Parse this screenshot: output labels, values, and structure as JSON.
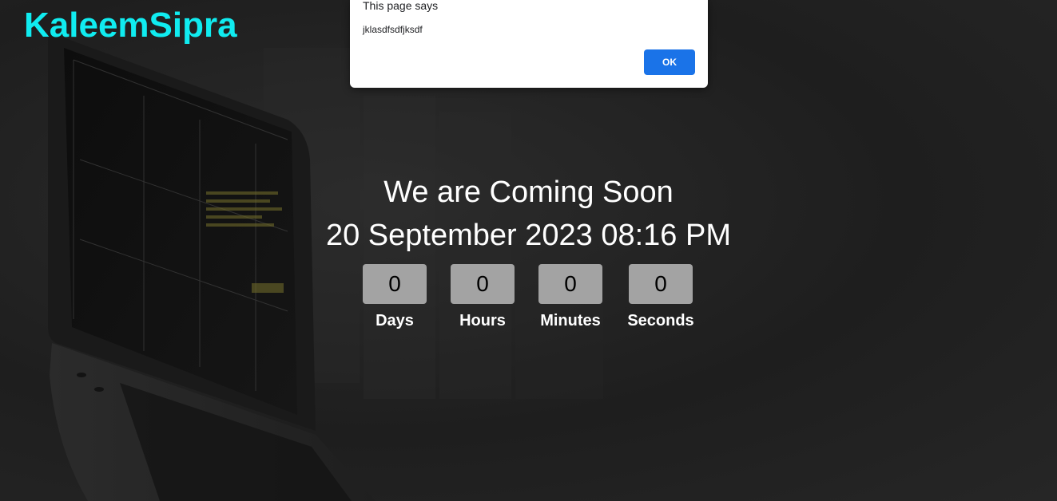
{
  "brand": {
    "name": "KaleemSipra"
  },
  "hero": {
    "headline": "We are Coming Soon",
    "launch_date": "20 September 2023 08:16 PM"
  },
  "countdown": {
    "units": [
      {
        "value": "0",
        "label": "Days"
      },
      {
        "value": "0",
        "label": "Hours"
      },
      {
        "value": "0",
        "label": "Minutes"
      },
      {
        "value": "0",
        "label": "Seconds"
      }
    ]
  },
  "alert": {
    "title": "This page says",
    "message": "jklasdfsdfjksdf",
    "ok_label": "OK"
  },
  "colors": {
    "brand": "#10ecf0",
    "background": "#232323",
    "countdown_box": "#a3a3a3",
    "dialog_button": "#1a73e8"
  },
  "icons": {
    "background_illustration": "laptop-illustration"
  }
}
